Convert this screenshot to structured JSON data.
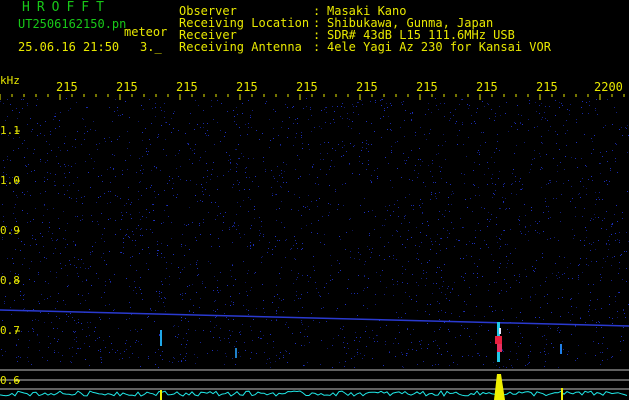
{
  "header": {
    "app_title": "HROFFT",
    "file_name": "UT2506162150.pn",
    "file_suffix": "meteor",
    "datetime": "25.06.16 21:50",
    "count": "3._",
    "fields": [
      {
        "label": "Observer",
        "sep": ":",
        "value": "Masaki Kano"
      },
      {
        "label": "Receiving Location",
        "sep": ":",
        "value": "Shibukawa, Gunma, Japan"
      },
      {
        "label": "Receiver",
        "sep": ":",
        "value": "SDR# 43dB L15 111.6MHz USB"
      },
      {
        "label": "Receiving Antenna",
        "sep": ":",
        "value": "4ele Yagi Az 230 for Kansai VOR"
      }
    ]
  },
  "axis": {
    "unit": "kHz",
    "x_ticks": [
      "215",
      "215",
      "215",
      "215",
      "215",
      "215",
      "215",
      "215",
      "215",
      "2200"
    ],
    "y_ticks": [
      "1.1",
      "1.0",
      "0.9",
      "0.8",
      "0.7",
      "0.6"
    ]
  },
  "colors": {
    "header_green": "#18c818",
    "label_yellow": "#e8e800",
    "background": "#000000",
    "noise_blue": "#1a2a9a",
    "signal_cyan": "#20e8e8",
    "meteor_red": "#e82040",
    "spectrum_yellow": "#f0f000"
  }
}
